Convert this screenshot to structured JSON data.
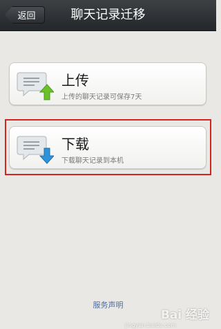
{
  "header": {
    "back_label": "返回",
    "title": "聊天记录迁移"
  },
  "options": {
    "upload": {
      "title": "上传",
      "subtitle": "上传的聊天记录可保存7天",
      "icon": "chat-upload-icon"
    },
    "download": {
      "title": "下载",
      "subtitle": "下载聊天记录到本机",
      "icon": "chat-download-icon",
      "highlighted": true
    }
  },
  "footer": {
    "link_label": "服务声明"
  },
  "watermark": {
    "brand": "Bai 经验",
    "url": "jingyan.baidu.com"
  },
  "colors": {
    "header_bg": "#2b2e32",
    "background": "#e9e8e4",
    "upload_arrow": "#6cc12b",
    "download_arrow": "#2e93d9",
    "highlight_border": "#d42420",
    "link": "#4b6fa3"
  }
}
